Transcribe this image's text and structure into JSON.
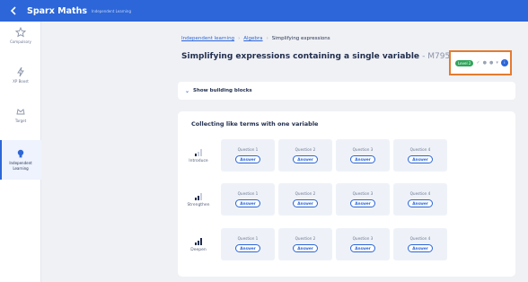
{
  "app": {
    "name": "Sparx Maths",
    "section": "Independent Learning"
  },
  "sidebar": {
    "items": [
      {
        "label": "Compulsory",
        "icon": "star-icon"
      },
      {
        "label": "XP Boost",
        "icon": "xp-boost-icon"
      },
      {
        "label": "Target",
        "icon": "target-icon"
      },
      {
        "label": "Independent Learning",
        "icon": "lightbulb-icon",
        "active": true
      }
    ]
  },
  "breadcrumb": {
    "items": [
      "Independent learning",
      "Algebra"
    ],
    "current": "Simplifying expressions"
  },
  "page": {
    "title": "Simplifying expressions containing a single variable",
    "code": "- M795"
  },
  "level": {
    "label": "Level 2"
  },
  "building_blocks": {
    "label": "Show building blocks"
  },
  "card": {
    "title": "Collecting like terms with one variable",
    "rows": [
      {
        "name": "Introduce",
        "bars": 1
      },
      {
        "name": "Strengthen",
        "bars": 2
      },
      {
        "name": "Deepen",
        "bars": 3
      }
    ],
    "questions": [
      "Question 1",
      "Question 2",
      "Question 3",
      "Question 4"
    ],
    "answer_label": "Answer"
  },
  "colors": {
    "brand": "#2c66d8",
    "highlight": "#e57b2f",
    "level": "#2fa45a"
  }
}
